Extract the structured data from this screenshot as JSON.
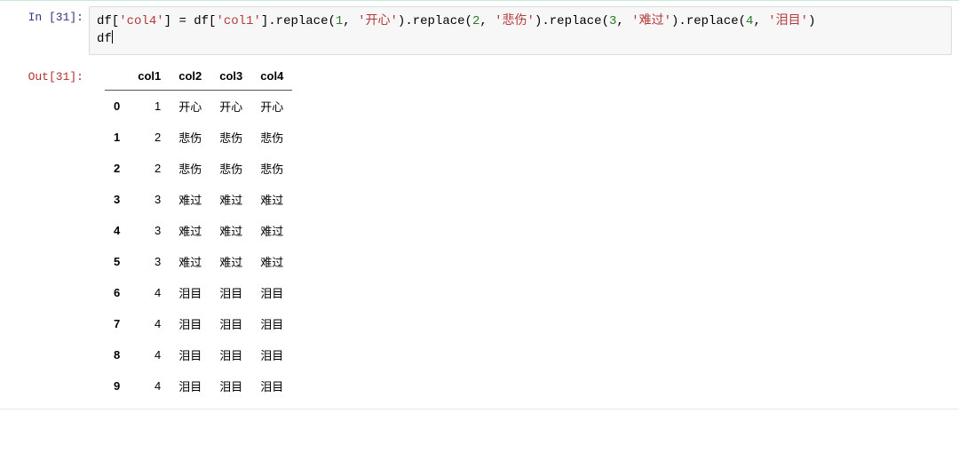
{
  "in_prompt": "In  [31]:",
  "out_prompt": "Out[31]:",
  "code": {
    "assign_lhs": "df[",
    "col4_str": "'col4'",
    "assign_eq": "] = df[",
    "col1_str": "'col1'",
    "close1": "].replace(",
    "num1": "1",
    "sep": ", ",
    "str1": "'开心'",
    "close2": ").replace(",
    "num2": "2",
    "str2": "'悲伤'",
    "close3": ").replace(",
    "num3": "3",
    "str3": "'难过'",
    "close4": ").replace(",
    "num4": "4",
    "str4": "'泪目'",
    "close5": ")",
    "line2": "df"
  },
  "table": {
    "columns": [
      "col1",
      "col2",
      "col3",
      "col4"
    ],
    "index": [
      "0",
      "1",
      "2",
      "3",
      "4",
      "5",
      "6",
      "7",
      "8",
      "9"
    ],
    "rows": [
      [
        "1",
        "开心",
        "开心",
        "开心"
      ],
      [
        "2",
        "悲伤",
        "悲伤",
        "悲伤"
      ],
      [
        "2",
        "悲伤",
        "悲伤",
        "悲伤"
      ],
      [
        "3",
        "难过",
        "难过",
        "难过"
      ],
      [
        "3",
        "难过",
        "难过",
        "难过"
      ],
      [
        "3",
        "难过",
        "难过",
        "难过"
      ],
      [
        "4",
        "泪目",
        "泪目",
        "泪目"
      ],
      [
        "4",
        "泪目",
        "泪目",
        "泪目"
      ],
      [
        "4",
        "泪目",
        "泪目",
        "泪目"
      ],
      [
        "4",
        "泪目",
        "泪目",
        "泪目"
      ]
    ]
  }
}
